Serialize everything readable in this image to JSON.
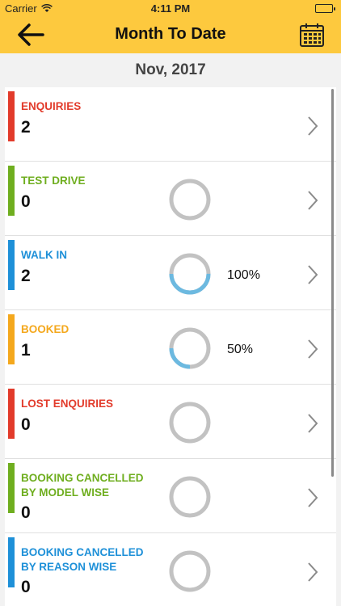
{
  "status": {
    "carrier": "Carrier",
    "time": "4:11 PM"
  },
  "nav": {
    "title": "Month To Date"
  },
  "month_label": "Nov, 2017",
  "rows": [
    {
      "label": "ENQUIRIES",
      "count": "2",
      "color": "#e23b2b",
      "ring": false,
      "progress": null,
      "percent": ""
    },
    {
      "label": "TEST DRIVE",
      "count": "0",
      "color": "#6fae1f",
      "ring": true,
      "progress": 0,
      "percent": ""
    },
    {
      "label": "WALK IN",
      "count": "2",
      "color": "#1e90d8",
      "ring": true,
      "progress": 1.0,
      "percent": "100%"
    },
    {
      "label": "BOOKED",
      "count": "1",
      "color": "#f4a81d",
      "ring": true,
      "progress": 0.5,
      "percent": "50%"
    },
    {
      "label": "LOST ENQUIRIES",
      "count": "0",
      "color": "#e23b2b",
      "ring": true,
      "progress": 0,
      "percent": ""
    },
    {
      "label": "BOOKING CANCELLED BY MODEL WISE",
      "count": "0",
      "color": "#6fae1f",
      "ring": true,
      "progress": 0,
      "percent": ""
    },
    {
      "label": "BOOKING CANCELLED BY REASON WISE",
      "count": "0",
      "color": "#1e90d8",
      "ring": true,
      "progress": 0,
      "percent": ""
    }
  ],
  "colors": {
    "brand": "#fdc93e",
    "ring_track": "#c2c2c2",
    "ring_fill": "#6cb9e0"
  }
}
